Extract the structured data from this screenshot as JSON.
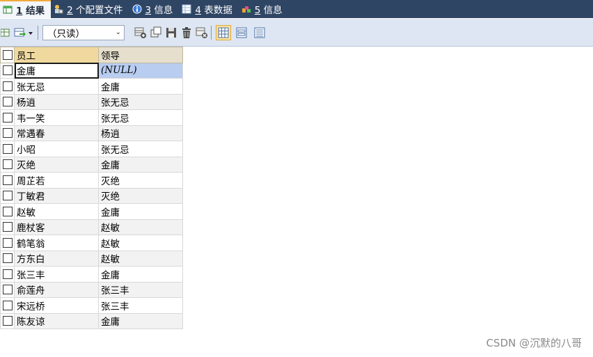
{
  "tabs": [
    {
      "num": "1",
      "label": "结果",
      "icon": "grid-result-icon"
    },
    {
      "num": "2",
      "label": "个配置文件",
      "icon": "profile-icon"
    },
    {
      "num": "3",
      "label": "信息",
      "icon": "info-icon"
    },
    {
      "num": "4",
      "label": "表数据",
      "icon": "table-data-icon"
    },
    {
      "num": "5",
      "label": "信息",
      "icon": "info-colorful-icon"
    }
  ],
  "toolbar": {
    "mode_select": "（只读）"
  },
  "grid": {
    "columns": [
      "员工",
      "领导"
    ],
    "rows": [
      [
        "金庸",
        "(NULL)"
      ],
      [
        "张无忌",
        "金庸"
      ],
      [
        "杨逍",
        "张无忌"
      ],
      [
        "韦一笑",
        "张无忌"
      ],
      [
        "常遇春",
        "杨逍"
      ],
      [
        "小昭",
        "张无忌"
      ],
      [
        "灭绝",
        "金庸"
      ],
      [
        "周芷若",
        "灭绝"
      ],
      [
        "丁敏君",
        "灭绝"
      ],
      [
        "赵敏",
        "金庸"
      ],
      [
        "鹿杖客",
        "赵敏"
      ],
      [
        "鹤笔翁",
        "赵敏"
      ],
      [
        "方东白",
        "赵敏"
      ],
      [
        "张三丰",
        "金庸"
      ],
      [
        "俞莲舟",
        "张三丰"
      ],
      [
        "宋远桥",
        "张三丰"
      ],
      [
        "陈友谅",
        "金庸"
      ]
    ]
  },
  "watermark": "CSDN @沉默的八哥",
  "colors": {
    "tabbar_bg": "#2f4564",
    "toolbar_bg": "#dde6f2",
    "selected_cell": "#b8cdf0",
    "header_bg": "#e6dfcd"
  }
}
